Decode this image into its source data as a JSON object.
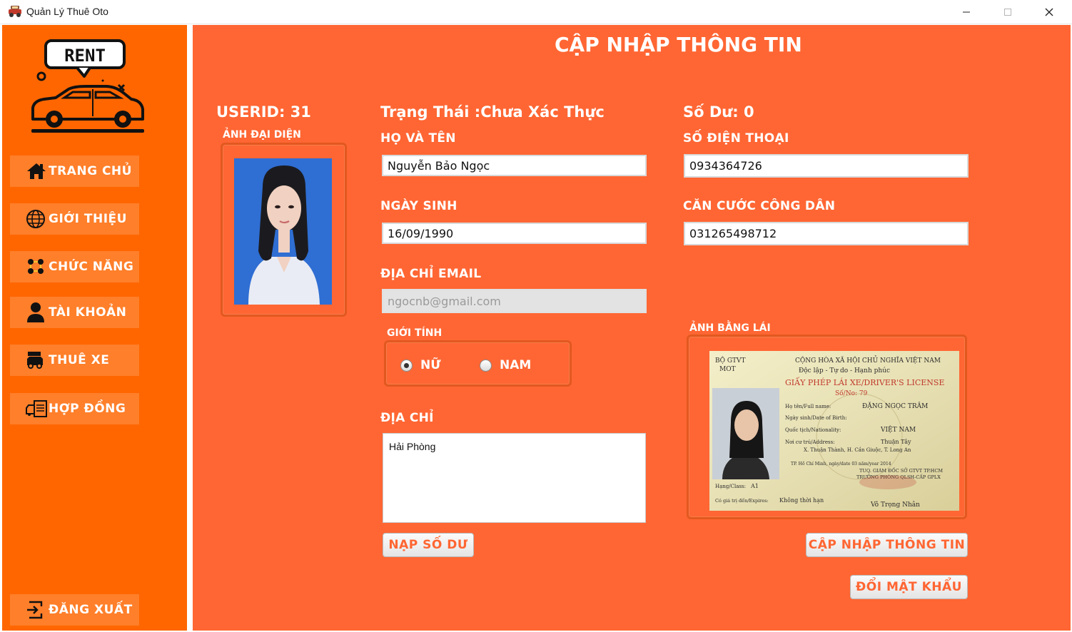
{
  "window": {
    "title": "Quản Lý Thuê Oto",
    "minimize_glyph": "—",
    "maximize_glyph": "☐",
    "close_glyph": "✕"
  },
  "logo": {
    "text": "RENT",
    "icon": "rent-car-logo"
  },
  "sidebar": {
    "items": [
      {
        "label": "TRANG CHỦ",
        "icon": "home-icon"
      },
      {
        "label": "GIỚI THIỆU",
        "icon": "globe-icon"
      },
      {
        "label": "CHỨC NĂNG",
        "icon": "features-icon"
      },
      {
        "label": "TÀI KHOẢN",
        "icon": "user-icon"
      },
      {
        "label": "THUÊ XE",
        "icon": "car-rental-icon"
      },
      {
        "label": "HỢP ĐỒNG",
        "icon": "contract-icon"
      }
    ],
    "logout": {
      "label": "ĐĂNG XUẤT",
      "icon": "logout-icon"
    }
  },
  "page": {
    "title": "CẬP NHẬP THÔNG TIN",
    "userid": "USERID: 31",
    "status": "Trạng Thái :Chưa Xác Thực",
    "balance": "Số Dư: 0",
    "avatar_label": "ẢNH ĐẠI DIỆN",
    "license_label": "ẢNH BẰNG LÁI"
  },
  "form": {
    "fullname_label": "HỌ VÀ TÊN",
    "fullname_value": "Nguyễn Bảo Ngọc",
    "phone_label": "SỐ ĐIỆN THOẠI",
    "phone_value": "0934364726",
    "dob_label": "NGÀY SINH",
    "dob_value": "16/09/1990",
    "id_label": "CĂN CƯỚC CÔNG DÂN",
    "id_value": "031265498712",
    "email_label": "ĐỊA CHỈ EMAIL",
    "email_value": "ngocnb@gmail.com",
    "gender_label": "GIỚI TÍNH",
    "gender_options": [
      "NỮ",
      "NAM"
    ],
    "gender_selected": "NỮ",
    "address_label": "ĐỊA CHỈ",
    "address_value": "Hải Phòng"
  },
  "buttons": {
    "topup": "NẠP SỐ DƯ",
    "update": "CẬP NHẬP THÔNG TIN",
    "change_password": "ĐỔI MẬT KHẨU"
  },
  "license_card": {
    "authority": "BỘ GTVT\nMOT",
    "nation": "CỘNG HÒA XÃ HỘI CHỦ NGHĨA VIỆT NAM",
    "motto": "Độc lập - Tự do - Hạnh phúc",
    "title": "GIẤY PHÉP LÁI XE/DRIVER'S LICENSE",
    "number": "Số/No: 79",
    "name_label": "Họ tên/Full name:",
    "name_value": "ĐẶNG NGỌC TRÂM",
    "dob_label": "Ngày sinh/Date of Birth:",
    "nationality_label": "Quốc tịch/Nationality:",
    "nationality_value": "VIỆT NAM",
    "residence_label": "Nơi cư trú/Address:",
    "residence_value": "Thuận Tây",
    "residence_value2": "X. Thuận Thành, H. Cần Giuộc, T. Long An",
    "issued": "TP. Hồ Chí Minh, ngày/date 03 năm/year 2014",
    "issuer": "TUQ. GIÁM ĐỐC SỞ GTVT TP.HCM",
    "issuer2": "TRƯỞNG PHÒNG QLSH-CẤP GPLX",
    "class_label": "Hạng/Class:",
    "class_value": "A1",
    "expiry_label": "Có giá trị đến/Expires:",
    "expiry_value": "Không thời hạn",
    "signer": "Võ Trọng Nhân"
  },
  "colors": {
    "sidebar": "#ff6600",
    "main": "#ff6633",
    "nav_button": "#ff7f2a",
    "button_text": "#ff6633"
  }
}
